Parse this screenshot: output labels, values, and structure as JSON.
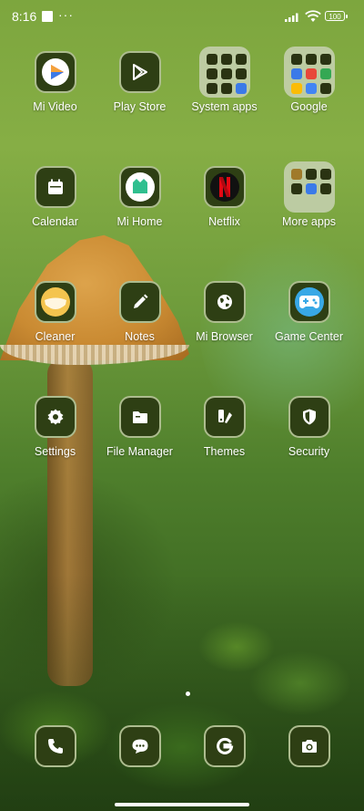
{
  "status_bar": {
    "time": "8:16",
    "overflow": "···",
    "battery": "100"
  },
  "apps": [
    {
      "label": "Mi Video",
      "icon": "mi-video-icon"
    },
    {
      "label": "Play Store",
      "icon": "play-store-icon"
    },
    {
      "label": "System apps",
      "icon": "folder-icon",
      "folder": true
    },
    {
      "label": "Google",
      "icon": "folder-icon",
      "folder": true
    },
    {
      "label": "Calendar",
      "icon": "calendar-icon"
    },
    {
      "label": "Mi Home",
      "icon": "mi-home-icon"
    },
    {
      "label": "Netflix",
      "icon": "netflix-icon"
    },
    {
      "label": "More apps",
      "icon": "folder-icon",
      "folder": true
    },
    {
      "label": "Cleaner",
      "icon": "cleaner-icon"
    },
    {
      "label": "Notes",
      "icon": "notes-icon"
    },
    {
      "label": "Mi Browser",
      "icon": "globe-icon"
    },
    {
      "label": "Game Center",
      "icon": "gamepad-icon"
    },
    {
      "label": "Settings",
      "icon": "gear-icon"
    },
    {
      "label": "File Manager",
      "icon": "folder-icon"
    },
    {
      "label": "Themes",
      "icon": "themes-icon"
    },
    {
      "label": "Security",
      "icon": "shield-icon"
    }
  ],
  "dock": [
    {
      "name": "phone",
      "icon": "phone-icon"
    },
    {
      "name": "messages",
      "icon": "message-icon"
    },
    {
      "name": "google",
      "icon": "google-icon"
    },
    {
      "name": "camera",
      "icon": "camera-icon"
    }
  ],
  "colors": {
    "icon_bg": "#2e3f14",
    "icon_border": "#c3d2a5",
    "netflix_red": "#e50914",
    "game_blue": "#38a8e6"
  }
}
